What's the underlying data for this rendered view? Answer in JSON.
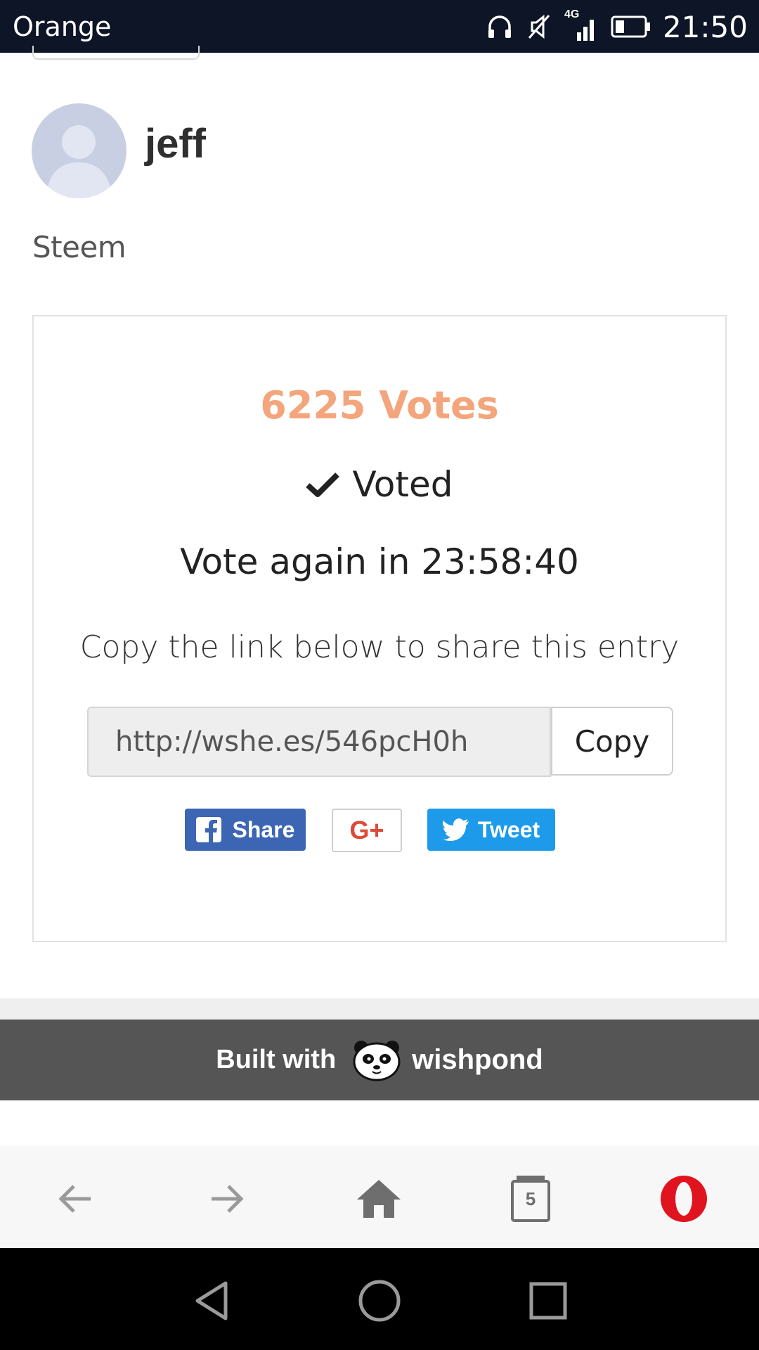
{
  "status_bar": {
    "carrier": "Orange",
    "network": "4G",
    "time": "21:50",
    "icons": [
      "headphones-icon",
      "mute-icon",
      "signal-icon",
      "battery-icon"
    ]
  },
  "entry": {
    "username": "jeff",
    "category": "Steem",
    "votes_label": "6225 Votes",
    "voted_label": "Voted",
    "countdown_label": "Vote again in 23:58:40",
    "copy_prompt": "Copy the link below to share this entry",
    "share_link": "http://wshe.es/546pcH0h",
    "copy_button": "Copy"
  },
  "social": {
    "facebook_label": "Share",
    "gplus_label": "G+",
    "twitter_label": "Tweet"
  },
  "footer": {
    "built_with": "Built with",
    "brand": "wishpond"
  },
  "browser_nav": {
    "tab_count": "5"
  },
  "colors": {
    "status_bar": "#0d1526",
    "votes": "#f4a57b",
    "facebook": "#3c65b4",
    "twitter": "#1d9bea",
    "gplus": "#dd4b39",
    "footer": "#555555",
    "opera": "#e0141e"
  }
}
